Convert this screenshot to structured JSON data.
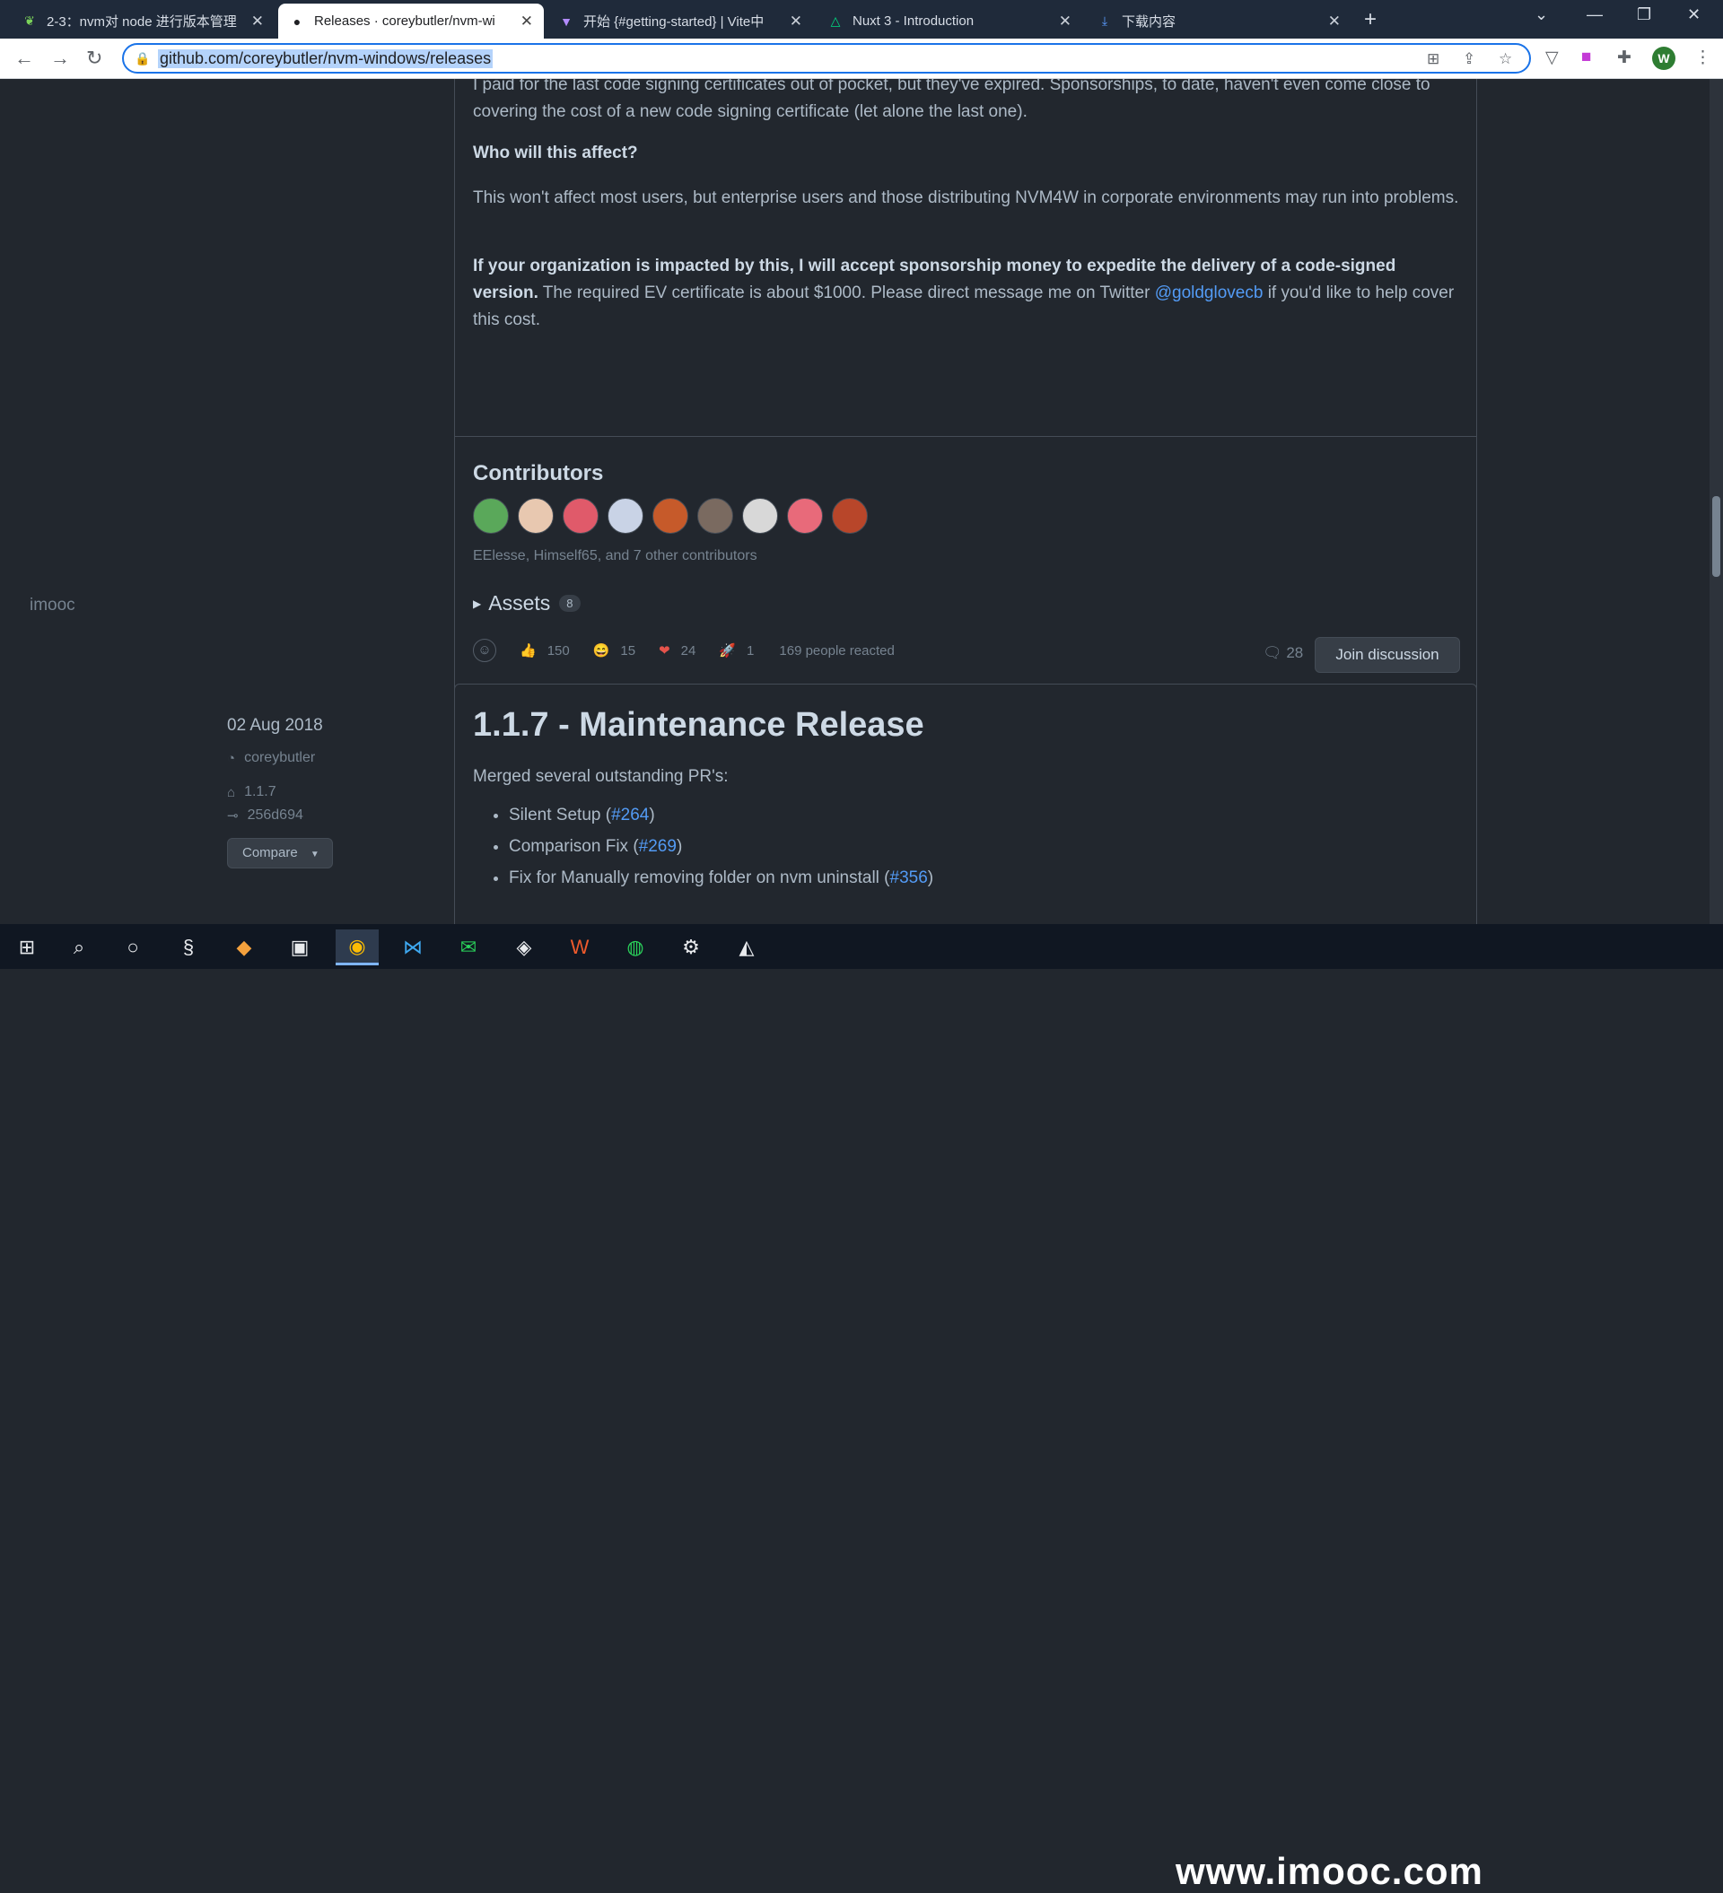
{
  "browser": {
    "tabs": [
      {
        "title": "2-3：nvm对 node 进行版本管理",
        "icon": "leaf-icon"
      },
      {
        "title": "Releases · coreybutler/nvm-wi",
        "icon": "github-icon"
      },
      {
        "title": "开始 {#getting-started} | Vite中",
        "icon": "vite-icon"
      },
      {
        "title": "Nuxt 3 - Introduction",
        "icon": "nuxt-icon"
      },
      {
        "title": "下载内容",
        "icon": "download-icon"
      }
    ],
    "url": "github.com/coreybutler/nvm-windows/releases"
  },
  "release_prev": {
    "paragraph1": "I paid for the last code signing certificates out of pocket, but they've expired. Sponsorships, to date, haven't even come close to covering the cost of a new code signing certificate (let alone the last one).",
    "heading": "Who will this affect?",
    "paragraph2": "This won't affect most users, but enterprise users and those distributing NVM4W in corporate environments may run into problems.",
    "paragraph3_bold": "If your organization is impacted by this, I will accept sponsorship money to expedite the delivery of a code-signed version.",
    "paragraph3_rest": " The required EV certificate is about $1000. Please direct message me on Twitter ",
    "twitter_link": "@goldglovecb",
    "paragraph3_end": " if you'd like to help cover this cost.",
    "contributors_heading": "Contributors",
    "contributor_avatar_colors": [
      "#5aa85a",
      "#e8c8b0",
      "#e05a6a",
      "#c9d3e6",
      "#c65a2a",
      "#7a6a60",
      "#d8d8d8",
      "#e86a7a",
      "#b8462a"
    ],
    "contributors_text": "EElesse, Himself65, and 7 other contributors",
    "assets_label": "Assets",
    "assets_count": "8",
    "reactions": [
      {
        "emoji": "👍",
        "count": "150"
      },
      {
        "emoji": "😄",
        "count": "15"
      },
      {
        "emoji": "❤",
        "count": "24"
      },
      {
        "emoji": "🚀",
        "count": "1"
      }
    ],
    "reacted_text": "169 people reacted",
    "comments_count": "28",
    "join_button": "Join discussion"
  },
  "sidebar": {
    "owner_label": "imooc",
    "date": "02 Aug 2018",
    "author": "coreybutler",
    "tag": "1.1.7",
    "commit": "256d694",
    "compare_button": "Compare"
  },
  "release_next": {
    "title": "1.1.7 - Maintenance Release",
    "intro": "Merged several outstanding PR's:",
    "items": [
      {
        "text": "Silent Setup (",
        "link": "#264",
        "end": ")"
      },
      {
        "text": "Comparison Fix (",
        "link": "#269",
        "end": ")"
      },
      {
        "text": "Fix for Manually removing folder on nvm uninstall (",
        "link": "#356",
        "end": ")"
      }
    ]
  },
  "taskbar": {
    "watermark": "www.imooc.com"
  }
}
